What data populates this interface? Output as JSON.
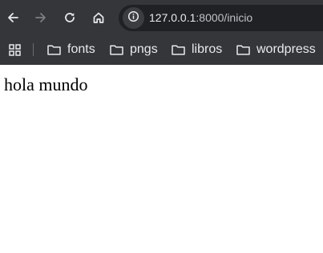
{
  "toolbar": {
    "back_icon": "arrow-left-icon",
    "forward_icon": "arrow-right-icon",
    "reload_icon": "reload-icon",
    "home_icon": "home-icon",
    "site_info_icon": "info-icon",
    "url_host": "127.0.0.1",
    "url_rest": ":8000/inicio"
  },
  "bookmarks": {
    "apps_icon": "apps-grid-icon",
    "items": [
      {
        "label": "fonts",
        "icon": "folder-icon"
      },
      {
        "label": "pngs",
        "icon": "folder-icon"
      },
      {
        "label": "libros",
        "icon": "folder-icon"
      },
      {
        "label": "wordpress",
        "icon": "folder-icon"
      }
    ]
  },
  "page": {
    "text": "hola mundo"
  },
  "colors": {
    "toolbar_bg": "#35363a",
    "omnibox_bg": "#202124",
    "text_light": "#e8eaed",
    "page_bg": "#ffffff"
  }
}
